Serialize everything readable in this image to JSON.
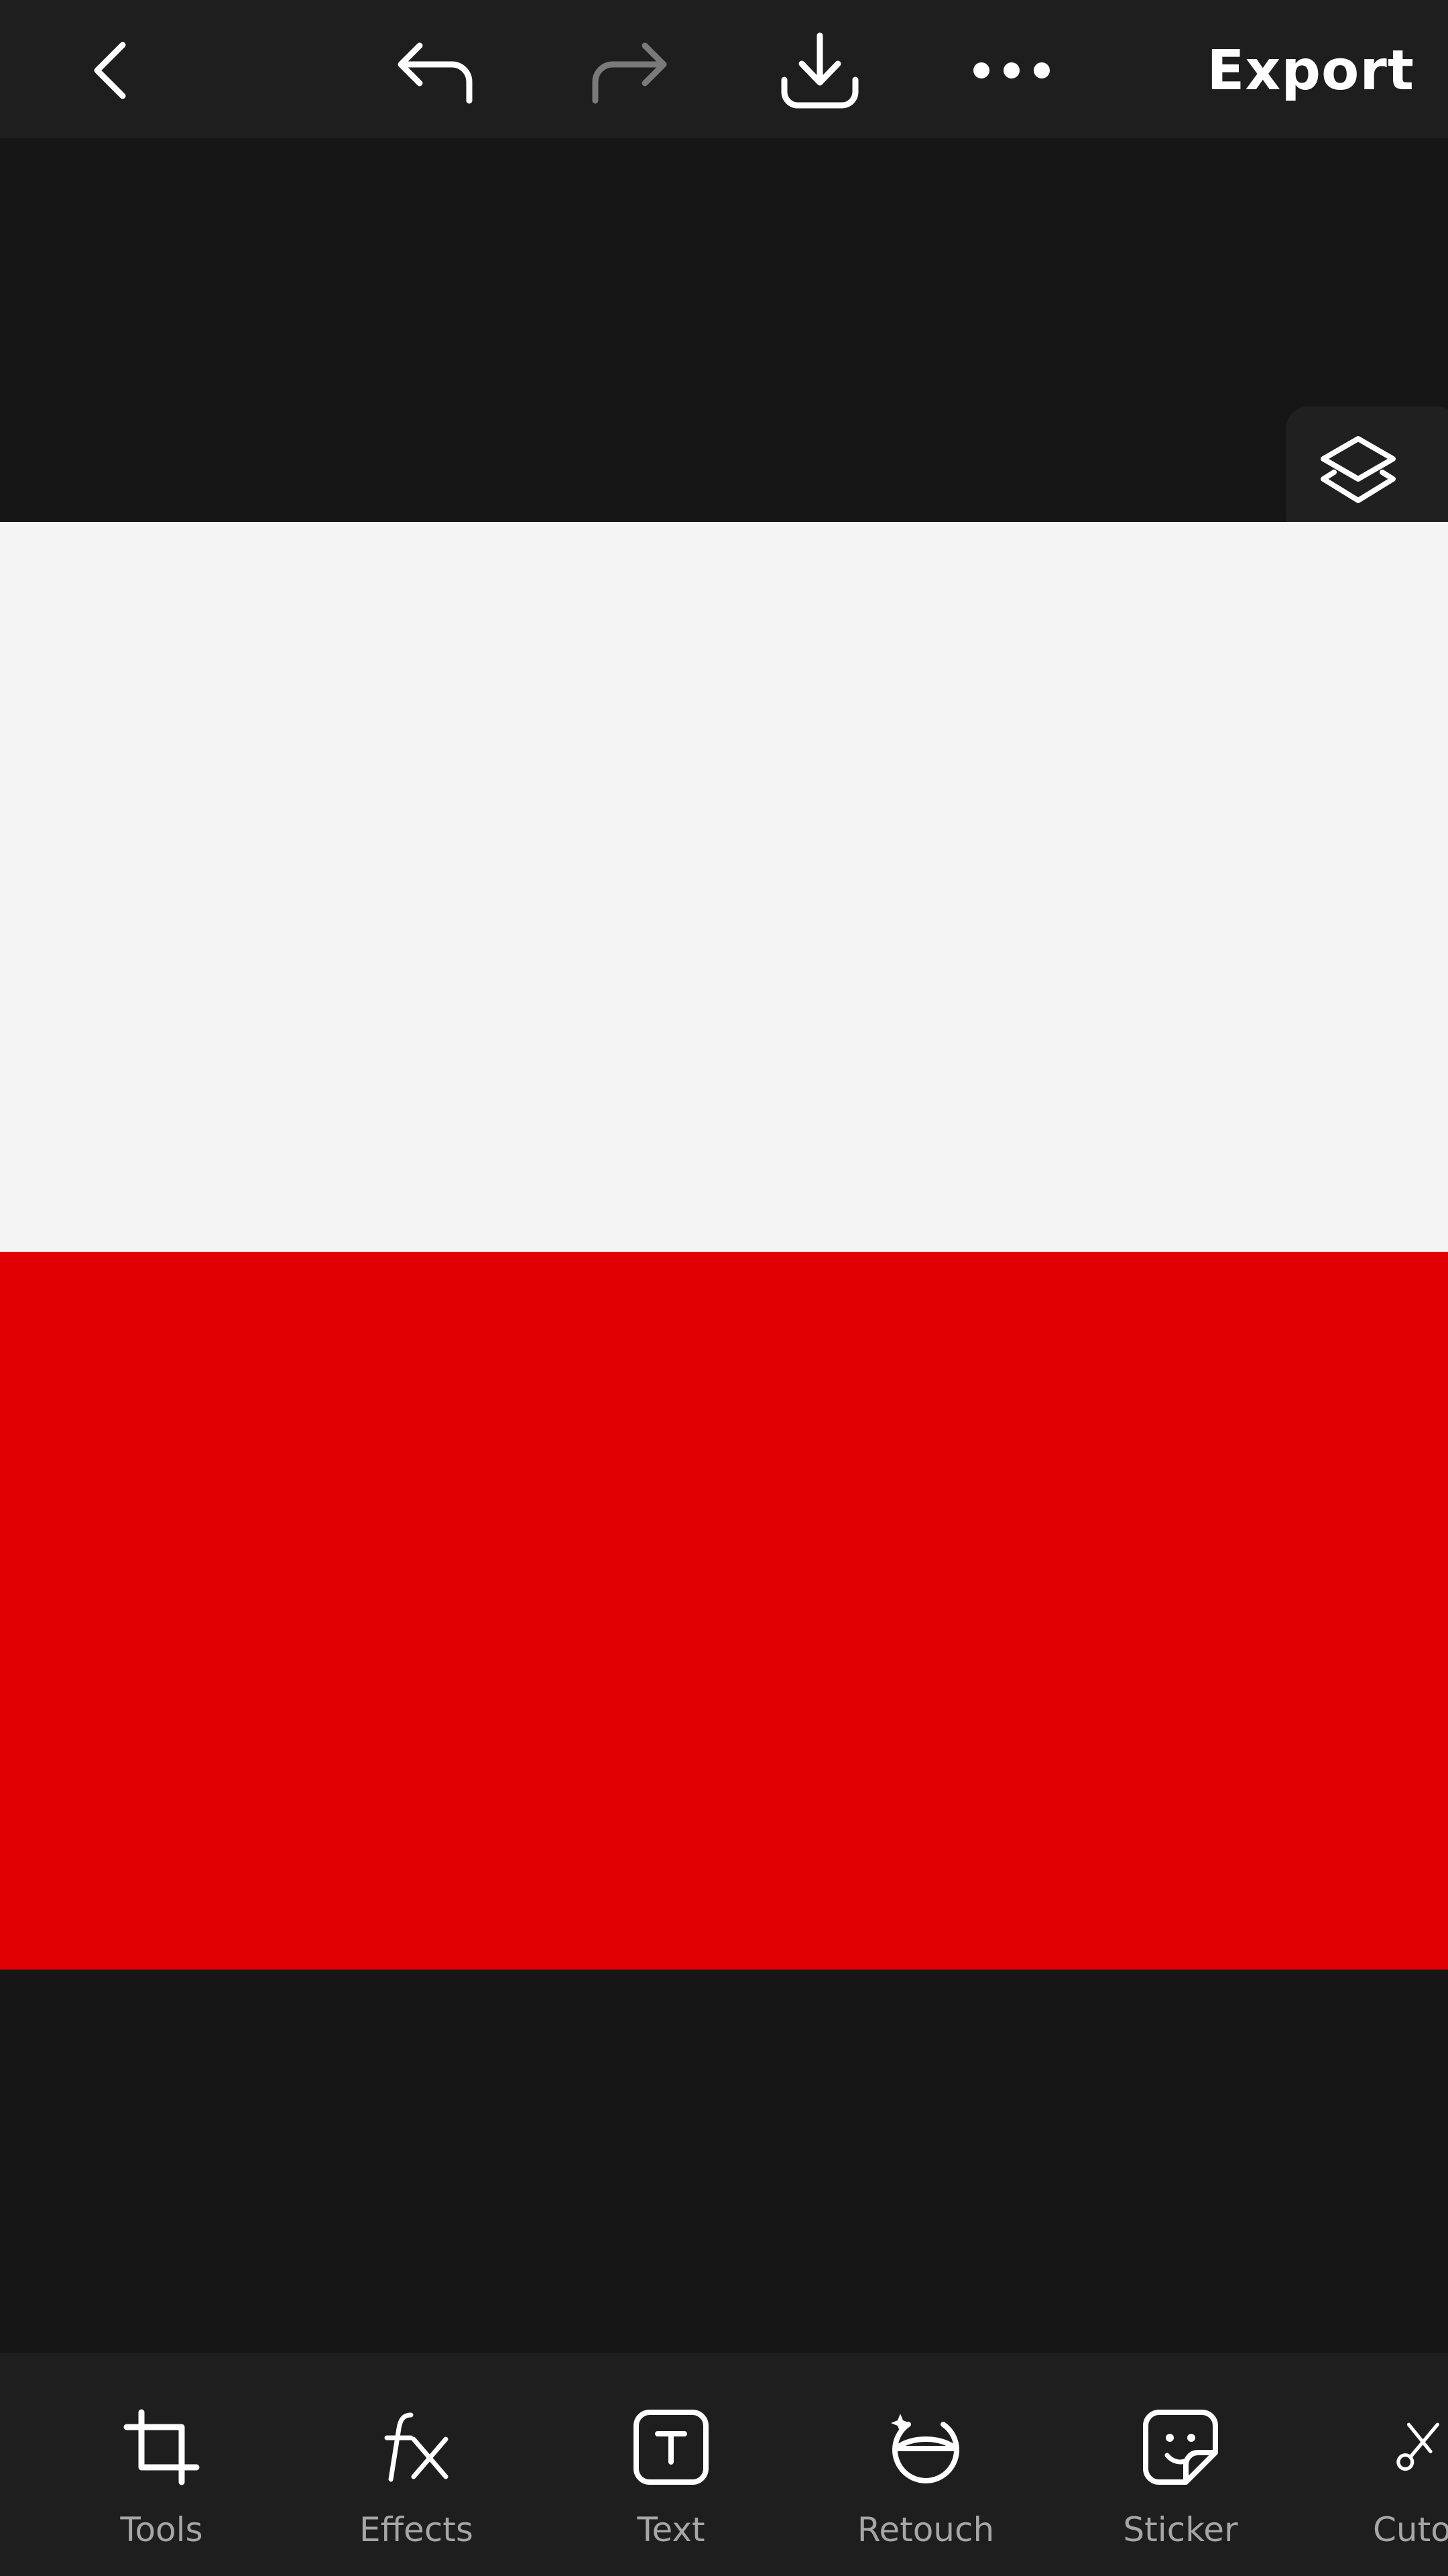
{
  "header": {
    "back_icon": "chevron-left-icon",
    "undo_icon": "undo-icon",
    "redo_icon": "redo-icon",
    "download_icon": "download-icon",
    "more_icon": "more-horizontal-icon",
    "export_label": "Export",
    "redo_enabled": false
  },
  "canvas": {
    "layers_icon": "layers-icon",
    "image": {
      "stripes": [
        {
          "color": "#f4f4f5"
        },
        {
          "color": "#e00004"
        }
      ]
    }
  },
  "toolbar": {
    "items": [
      {
        "label": "Tools",
        "icon": "crop-icon"
      },
      {
        "label": "Effects",
        "icon": "fx-icon"
      },
      {
        "label": "Text",
        "icon": "text-box-icon"
      },
      {
        "label": "Retouch",
        "icon": "retouch-face-icon"
      },
      {
        "label": "Sticker",
        "icon": "sticker-icon"
      },
      {
        "label": "Cuto",
        "icon": "scissors-icon"
      }
    ]
  },
  "colors": {
    "background": "#161616",
    "bar": "#1e1e1f",
    "label": "#a6a6a6",
    "disabled_icon": "#7a7a7a"
  }
}
